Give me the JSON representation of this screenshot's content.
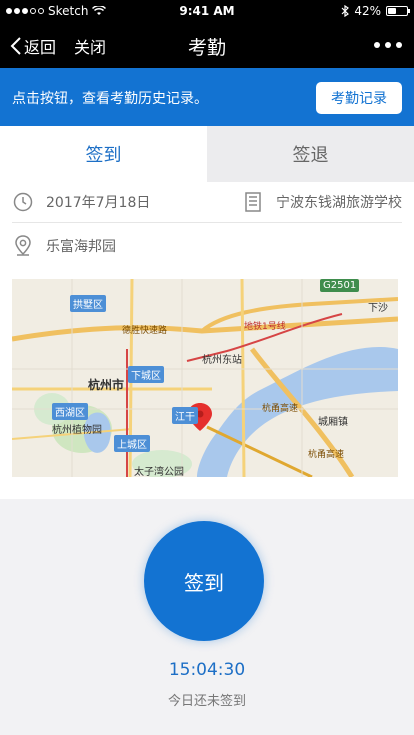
{
  "status_bar": {
    "carrier": "Sketch",
    "time": "9:41 AM",
    "battery": "42%",
    "battery_level": 0.42
  },
  "nav": {
    "back_label": "返回",
    "close_label": "关闭",
    "title": "考勤"
  },
  "hint_bar": {
    "text": "点击按钮，查看考勤历史记录。",
    "button_label": "考勤记录"
  },
  "tabs": [
    {
      "label": "签到",
      "active": true
    },
    {
      "label": "签退",
      "active": false
    }
  ],
  "info": {
    "date": "2017年7月18日",
    "school": "宁波东钱湖旅游学校",
    "location": "乐富海邦园"
  },
  "map": {
    "labels": {
      "gongshu": "拱墅区",
      "xiacheng": "下城区",
      "hangzhou": "杭州市",
      "xihu": "西湖区",
      "shangcheng": "上城区",
      "jianggan": "江干",
      "hangzhou_east": "杭州东站",
      "botanical": "杭州植物园",
      "taiziwan": "太子湾公园",
      "chengchao": "城厢镇",
      "xiasha": "下沙",
      "g2501": "G2501",
      "metro1": "地铁1号线"
    },
    "roads": {
      "desheng": "德胜快速路",
      "hangyong": "杭甬高速",
      "hangnan": "杭甬高速"
    }
  },
  "sign": {
    "button_label": "签到",
    "time": "15:04:30",
    "status": "今日还未签到"
  },
  "colors": {
    "primary": "#1373d2",
    "nav_bg": "#000000"
  }
}
